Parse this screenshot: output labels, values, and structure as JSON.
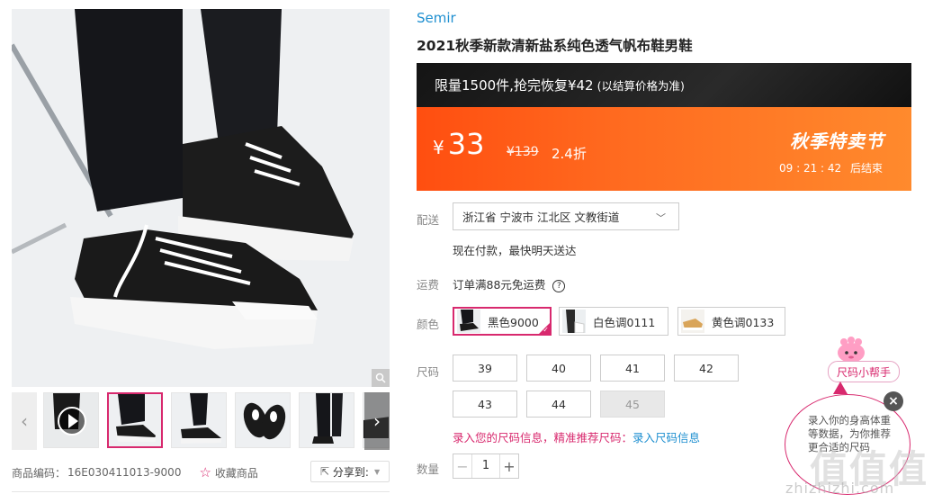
{
  "gallery": {
    "thumb_count": 6,
    "selected_thumb": 2
  },
  "meta": {
    "product_code_label": "商品编码：",
    "product_code": "16E030411013-9000",
    "favorite_label": "收藏商品",
    "share_label": "分享到:"
  },
  "brand": "Semir",
  "title": "2021秋季新款清新盐系纯色透气帆布鞋男鞋",
  "promo": {
    "limit_text": "限量1500件,抢完恢复¥42",
    "limit_note": "(以结算价格为准)",
    "currency": "¥",
    "price": "33",
    "original_price": "¥139",
    "discount": "2.4折",
    "festival": "秋季特卖节",
    "countdown": "09 : 21 : 42",
    "countdown_suffix": "后结束"
  },
  "delivery": {
    "label": "配送",
    "address": "浙江省 宁波市 江北区 文教街道",
    "note": "现在付款，最快明天送达"
  },
  "shipping": {
    "label": "运费",
    "text": "订单满88元免运费"
  },
  "colors": {
    "label": "颜色",
    "options": [
      {
        "name": "黑色9000",
        "selected": true
      },
      {
        "name": "白色调0111",
        "selected": false
      },
      {
        "name": "黄色调0133",
        "selected": false
      }
    ]
  },
  "sizes": {
    "label": "尺码",
    "options": [
      "39",
      "40",
      "41",
      "42",
      "43",
      "44",
      "45"
    ],
    "disabled": [
      "45"
    ],
    "tip_pink": "录入您的尺码信息，精准推荐尺码：",
    "tip_link": "录入尺码信息"
  },
  "quantity": {
    "label": "数量",
    "value": "1"
  },
  "helper": {
    "title": "尺码小帮手",
    "bubble_text": "录入你的身高体重等数据，为你推荐更合适的尺码"
  },
  "watermark": {
    "cn": "值值值",
    "en": "zhizhizhi.com"
  },
  "colors_hex": {
    "accent": "#d8296e",
    "link": "#1e8fd0",
    "promo_orange": "#ff5a15"
  }
}
